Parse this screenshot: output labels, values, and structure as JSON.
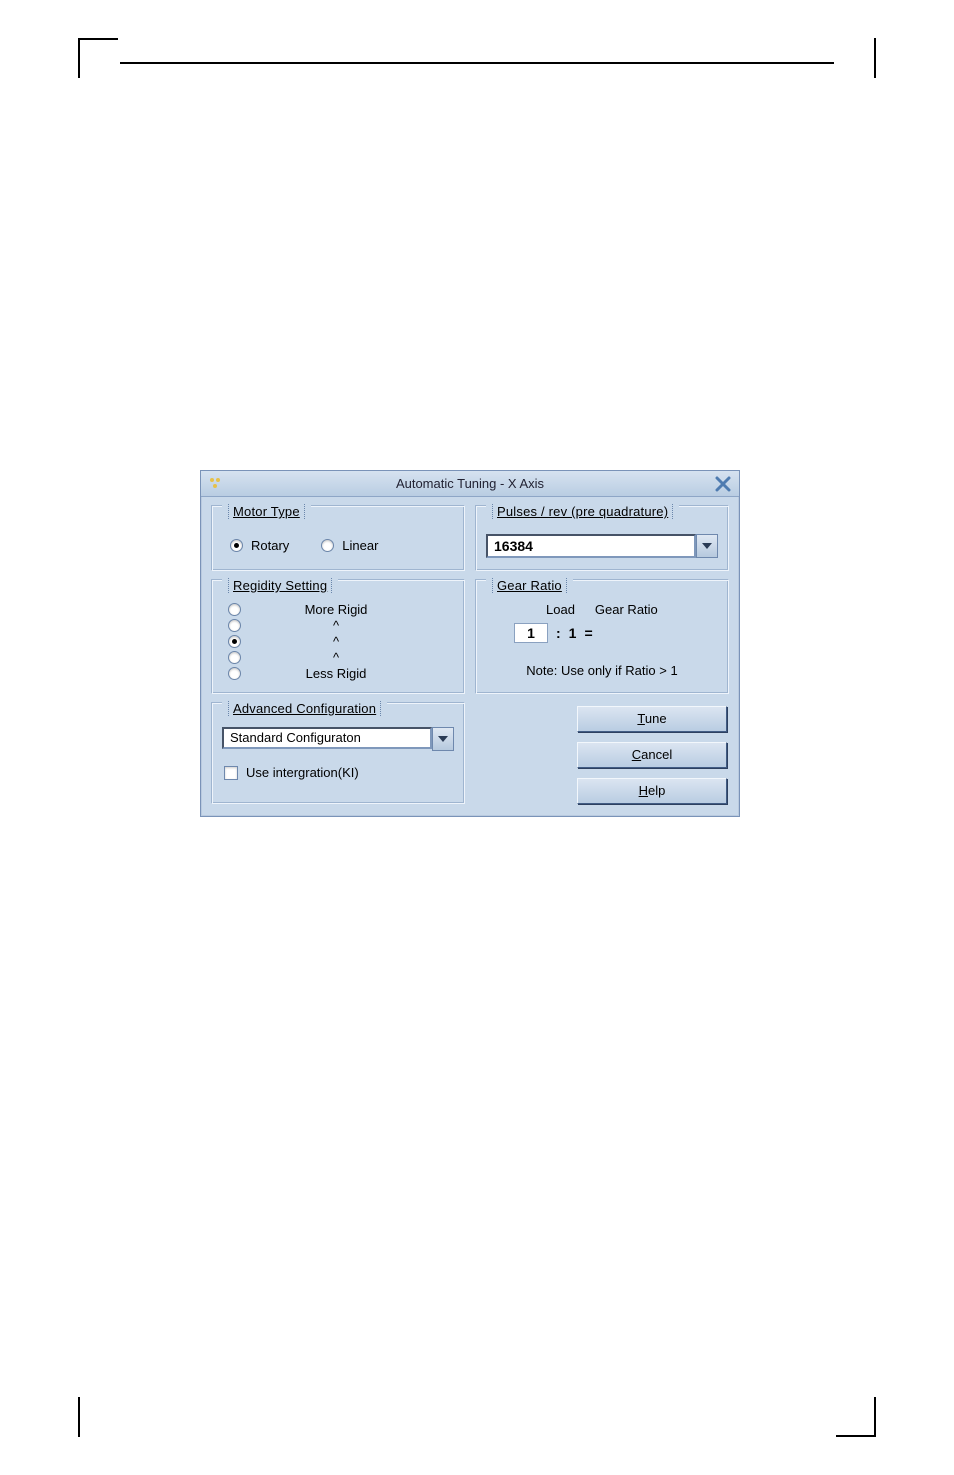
{
  "dialog": {
    "title": "Automatic Tuning - X Axis"
  },
  "motor_type": {
    "legend": "Motor Type",
    "rotary_label": "Rotary",
    "linear_label": "Linear"
  },
  "pulses": {
    "legend": "Pulses / rev (pre quadrature)",
    "value": "16384"
  },
  "rigidity": {
    "legend": "Regidity Setting",
    "more_label": "More Rigid",
    "less_label": "Less Rigid",
    "caret": "^"
  },
  "gear": {
    "legend": "Gear Ratio",
    "load_label": "Load",
    "ratio_label": "Gear Ratio",
    "input_value": "1",
    "colon": ":",
    "one": "1",
    "equals": "=",
    "note": "Note: Use only if Ratio > 1"
  },
  "advanced": {
    "legend": "Advanced Configuration",
    "selected": "Standard Configuraton",
    "use_ki_label": "Use intergration(KI)"
  },
  "buttons": {
    "tune_u": "T",
    "tune_rest": "une",
    "cancel_u": "C",
    "cancel_rest": "ancel",
    "help_u": "H",
    "help_rest": "elp"
  }
}
